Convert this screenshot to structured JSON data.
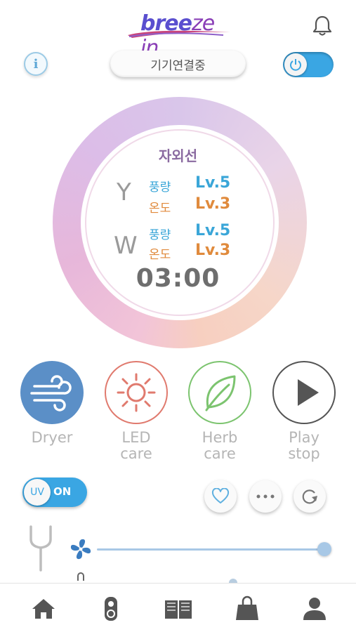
{
  "header": {
    "logo_part1": "bree",
    "logo_part2": "ze",
    "logo_part3": "in",
    "connection_status": "기기연결중"
  },
  "gauge": {
    "mode_title": "자외선",
    "channels": [
      {
        "letter": "Y",
        "fan_label": "풍량",
        "fan_level": "Lv.5",
        "temp_label": "온도",
        "temp_level": "Lv.3"
      },
      {
        "letter": "W",
        "fan_label": "풍량",
        "fan_level": "Lv.5",
        "temp_label": "온도",
        "temp_level": "Lv.3"
      }
    ],
    "timer": "03:00"
  },
  "functions": [
    {
      "label_line1": "Dryer",
      "label_line2": ""
    },
    {
      "label_line1": "LED",
      "label_line2": "care"
    },
    {
      "label_line1": "Herb",
      "label_line2": "care"
    },
    {
      "label_line1": "Play",
      "label_line2": "stop"
    }
  ],
  "uv_toggle": {
    "knob_label": "UV",
    "state_label": "ON"
  },
  "slider": {
    "value_fraction": 1.0
  },
  "colors": {
    "accent_blue": "#3aa6e3",
    "dryer_blue": "#5b8fc7",
    "led_red": "#e07a6e",
    "herb_green": "#7cc46f",
    "play_gray": "#555555",
    "fan_blue": "#3a7cc0"
  },
  "icons": {
    "bell": "bell-icon",
    "info": "info-icon",
    "power": "power-icon",
    "dryer": "wind-icon",
    "led": "sun-icon",
    "herb": "leaf-icon",
    "play": "play-icon",
    "favorite": "heart-icon",
    "more": "more-icon",
    "refresh": "refresh-icon",
    "fan": "fan-icon",
    "nav": [
      "home-icon",
      "remote-icon",
      "book-icon",
      "bag-icon",
      "user-icon"
    ]
  }
}
